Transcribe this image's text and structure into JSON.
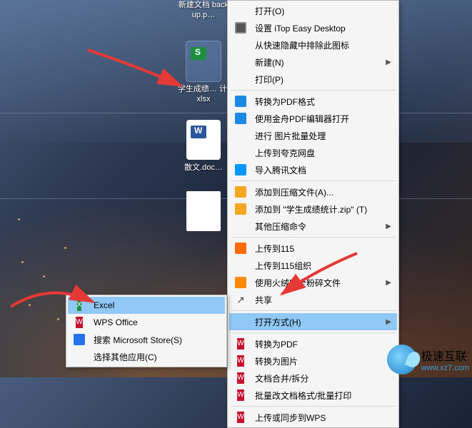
{
  "desktop": {
    "icons": [
      {
        "label": "新建文档\nbackup.p…"
      },
      {
        "label": "学生成绩…\n计.xlsx"
      },
      {
        "label": "散文.doc…"
      },
      {
        "label": ""
      }
    ]
  },
  "menu": {
    "items": [
      {
        "label": "打开(O)",
        "icon": ""
      },
      {
        "label": "设置 iTop Easy Desktop",
        "icon": "itop"
      },
      {
        "label": "从快速隐藏中排除此图标",
        "icon": ""
      },
      {
        "label": "新建(N)",
        "icon": "",
        "sub": true
      },
      {
        "label": "打印(P)",
        "icon": ""
      },
      {
        "sep": true
      },
      {
        "label": "转换为PDF格式",
        "icon": "pdf-blue"
      },
      {
        "label": "使用金舟PDF编辑器打开",
        "icon": "pdf-blue"
      },
      {
        "label": "进行 图片批量处理",
        "icon": ""
      },
      {
        "label": "上传到夸克网盘",
        "icon": ""
      },
      {
        "label": "导入腾讯文档",
        "icon": "tencent"
      },
      {
        "sep": true
      },
      {
        "label": "添加到压缩文件(A)...",
        "icon": "zip"
      },
      {
        "label": "添加到 \"学生成绩统计.zip\" (T)",
        "icon": "zip"
      },
      {
        "label": "其他压缩命令",
        "icon": "",
        "sub": true
      },
      {
        "sep": true
      },
      {
        "label": "上传到115",
        "icon": "115"
      },
      {
        "label": "上传到115组织",
        "icon": ""
      },
      {
        "label": "使用火绒安全粉碎文件",
        "icon": "huorong",
        "sub": true
      },
      {
        "label": "共享",
        "icon": "share"
      },
      {
        "sep": true
      },
      {
        "label": "打开方式(H)",
        "icon": "",
        "sub": true,
        "highlight": true
      },
      {
        "sep": true
      },
      {
        "label": "转换为PDF",
        "icon": "wps"
      },
      {
        "label": "转换为图片",
        "icon": "wps"
      },
      {
        "label": "文档合并/拆分",
        "icon": "wps"
      },
      {
        "label": "批量改文档格式/批量打印",
        "icon": "wps"
      },
      {
        "sep": true
      },
      {
        "label": "上传或同步到WPS",
        "icon": "wps"
      }
    ]
  },
  "submenu": {
    "items": [
      {
        "label": "Excel",
        "icon": "excel",
        "highlight": true
      },
      {
        "label": "WPS Office",
        "icon": "wps"
      },
      {
        "label": "搜索 Microsoft Store(S)",
        "icon": "store"
      },
      {
        "label": "选择其他应用(C)",
        "icon": ""
      }
    ]
  },
  "watermark": {
    "name": "极速互联",
    "url": "www.xz7.com"
  }
}
